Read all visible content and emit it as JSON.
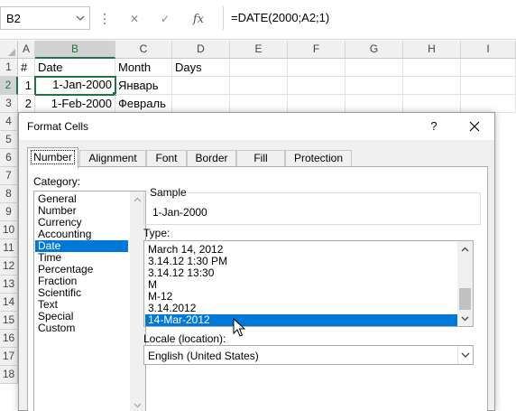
{
  "formula_bar": {
    "name_box": "B2",
    "cancel_glyph": "✕",
    "enter_glyph": "✓",
    "fx_label": "fx",
    "formula": "=DATE(2000;A2;1)"
  },
  "grid": {
    "columns": [
      "A",
      "B",
      "C",
      "D",
      "E",
      "F",
      "G",
      "H",
      "I"
    ],
    "rows": [
      "1",
      "2",
      "3",
      "4",
      "5",
      "6",
      "7",
      "8",
      "9",
      "10",
      "11",
      "12",
      "13",
      "14",
      "15",
      "16",
      "17",
      "18"
    ],
    "cells": {
      "A1": "#",
      "B1": "Date",
      "C1": "Month",
      "D1": "Days",
      "A2": "1",
      "B2": "1-Jan-2000",
      "C2": "Январь",
      "A3": "2",
      "B3": "1-Feb-2000",
      "C3": "Февраль"
    }
  },
  "dialog": {
    "title": "Format Cells",
    "help": "?",
    "tabs": [
      "Number",
      "Alignment",
      "Font",
      "Border",
      "Fill",
      "Protection"
    ],
    "category_label": "Category:",
    "categories": [
      "General",
      "Number",
      "Currency",
      "Accounting",
      "Date",
      "Time",
      "Percentage",
      "Fraction",
      "Scientific",
      "Text",
      "Special",
      "Custom"
    ],
    "selected_category": "Date",
    "sample_label": "Sample",
    "sample_value": "1-Jan-2000",
    "type_label": "Type:",
    "types": [
      "March 14, 2012",
      "3.14.12 1:30 PM",
      "3.14.12 13:30",
      "M",
      "M-12",
      "3.14.2012",
      "14-Mar-2012"
    ],
    "selected_type": "14-Mar-2012",
    "locale_label": "Locale (location):",
    "locale_value": "English (United States)"
  },
  "colors": {
    "excel_green": "#217346",
    "selection_blue": "#0078d7",
    "dialog_bg": "#f0f0f0"
  }
}
